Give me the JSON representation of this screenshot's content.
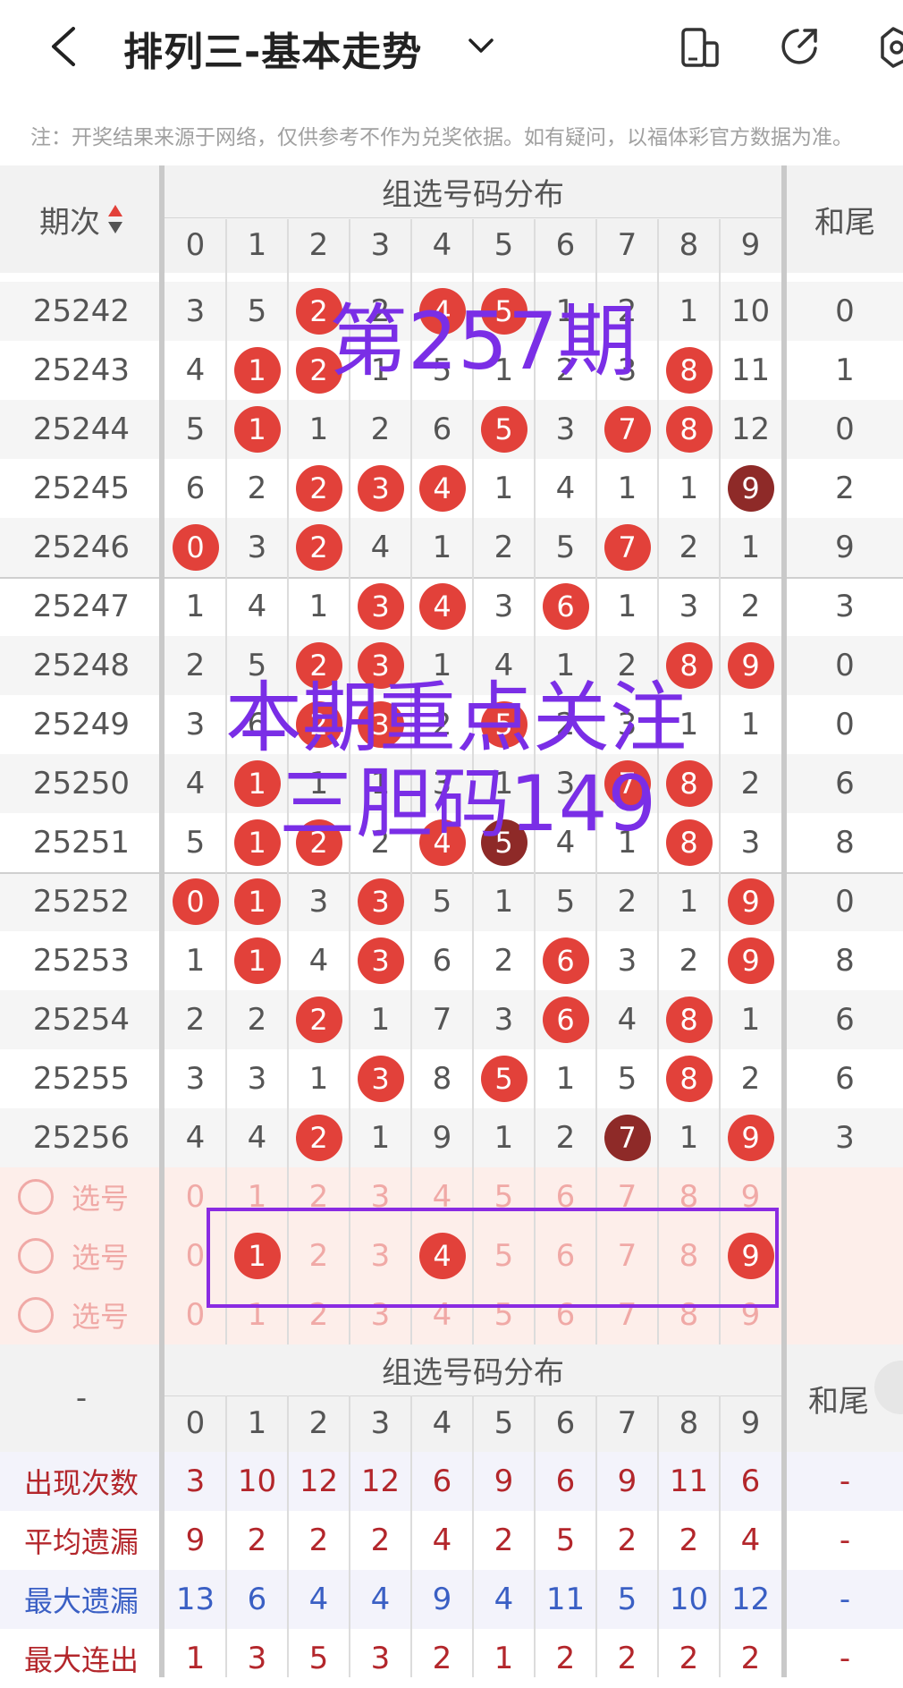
{
  "header": {
    "title": "排列三-基本走势"
  },
  "notice": "注：开奖结果来源于网络，仅供参考不作为兑奖依据。如有疑问，以福体彩官方数据为准。",
  "table": {
    "col_period": "期次",
    "col_group": "组选号码分布",
    "col_tail": "和尾",
    "digits": [
      "0",
      "1",
      "2",
      "3",
      "4",
      "5",
      "6",
      "7",
      "8",
      "9"
    ],
    "rows": [
      {
        "period": "25242",
        "cells": [
          "3",
          "5",
          "2",
          "2",
          "4",
          "5",
          "1",
          "2",
          "1",
          "10"
        ],
        "tail": "0"
      },
      {
        "period": "25243",
        "cells": [
          "4",
          "1",
          "2",
          "1",
          "5",
          "1",
          "2",
          "3",
          "8",
          "11"
        ],
        "tail": "1"
      },
      {
        "period": "25244",
        "cells": [
          "5",
          "1",
          "1",
          "2",
          "6",
          "5",
          "3",
          "7",
          "8",
          "12"
        ],
        "tail": "0"
      },
      {
        "period": "25245",
        "cells": [
          "6",
          "2",
          "2",
          "3",
          "4",
          "1",
          "4",
          "1",
          "1",
          "9"
        ],
        "tail": "2"
      },
      {
        "period": "25246",
        "cells": [
          "0",
          "3",
          "2",
          "4",
          "1",
          "2",
          "5",
          "7",
          "2",
          "1"
        ],
        "tail": "9"
      },
      {
        "period": "25247",
        "cells": [
          "1",
          "4",
          "1",
          "3",
          "4",
          "3",
          "6",
          "1",
          "3",
          "2"
        ],
        "tail": "3"
      },
      {
        "period": "25248",
        "cells": [
          "2",
          "5",
          "2",
          "3",
          "1",
          "4",
          "1",
          "2",
          "8",
          "9"
        ],
        "tail": "0"
      },
      {
        "period": "25249",
        "cells": [
          "3",
          "6",
          "2",
          "3",
          "2",
          "5",
          "2",
          "3",
          "1",
          "1"
        ],
        "tail": "0"
      },
      {
        "period": "25250",
        "cells": [
          "4",
          "1",
          "1",
          "1",
          "3",
          "1",
          "3",
          "7",
          "8",
          "2"
        ],
        "tail": "6"
      },
      {
        "period": "25251",
        "cells": [
          "5",
          "1",
          "2",
          "2",
          "4",
          "5",
          "4",
          "1",
          "8",
          "3"
        ],
        "tail": "8"
      },
      {
        "period": "25252",
        "cells": [
          "0",
          "1",
          "3",
          "3",
          "5",
          "1",
          "5",
          "2",
          "1",
          "9"
        ],
        "tail": "0"
      },
      {
        "period": "25253",
        "cells": [
          "1",
          "1",
          "4",
          "3",
          "6",
          "2",
          "6",
          "3",
          "2",
          "9"
        ],
        "tail": "8"
      },
      {
        "period": "25254",
        "cells": [
          "2",
          "2",
          "2",
          "1",
          "7",
          "3",
          "6",
          "4",
          "8",
          "1"
        ],
        "tail": "6"
      },
      {
        "period": "25255",
        "cells": [
          "3",
          "3",
          "1",
          "3",
          "8",
          "5",
          "1",
          "5",
          "8",
          "2"
        ],
        "tail": "6"
      },
      {
        "period": "25256",
        "cells": [
          "4",
          "4",
          "2",
          "1",
          "9",
          "1",
          "2",
          "7",
          "1",
          "9"
        ],
        "tail": "3"
      }
    ],
    "select_label": "选号",
    "select_rows": [
      {
        "picked": []
      },
      {
        "picked": [
          1,
          4,
          9
        ]
      },
      {
        "picked": []
      }
    ]
  },
  "stats": {
    "col_period": "-",
    "col_group": "组选号码分布",
    "col_tail": "和尾",
    "rows": [
      {
        "label": "出现次数",
        "color": "#b3262b",
        "values": [
          "3",
          "10",
          "12",
          "12",
          "6",
          "9",
          "6",
          "9",
          "11",
          "6"
        ],
        "tail": "-"
      },
      {
        "label": "平均遗漏",
        "color": "#b3262b",
        "values": [
          "9",
          "2",
          "2",
          "2",
          "4",
          "2",
          "5",
          "2",
          "2",
          "4"
        ],
        "tail": "-"
      },
      {
        "label": "最大遗漏",
        "color": "#3a5fc4",
        "values": [
          "13",
          "6",
          "4",
          "4",
          "9",
          "4",
          "11",
          "5",
          "10",
          "12"
        ],
        "tail": "-"
      },
      {
        "label": "最大连出",
        "color": "#b3262b",
        "values": [
          "1",
          "3",
          "5",
          "3",
          "2",
          "1",
          "2",
          "2",
          "2",
          "2"
        ],
        "tail": "-"
      }
    ]
  },
  "overlays": {
    "line1": "第257期",
    "line2": "本期重点关注",
    "line3": "三胆码149"
  },
  "colors": {
    "ball": "#e2413a",
    "ball_dark": "#8e2a28",
    "overlay": "#7a2ee6",
    "box": "#8a2be2"
  }
}
